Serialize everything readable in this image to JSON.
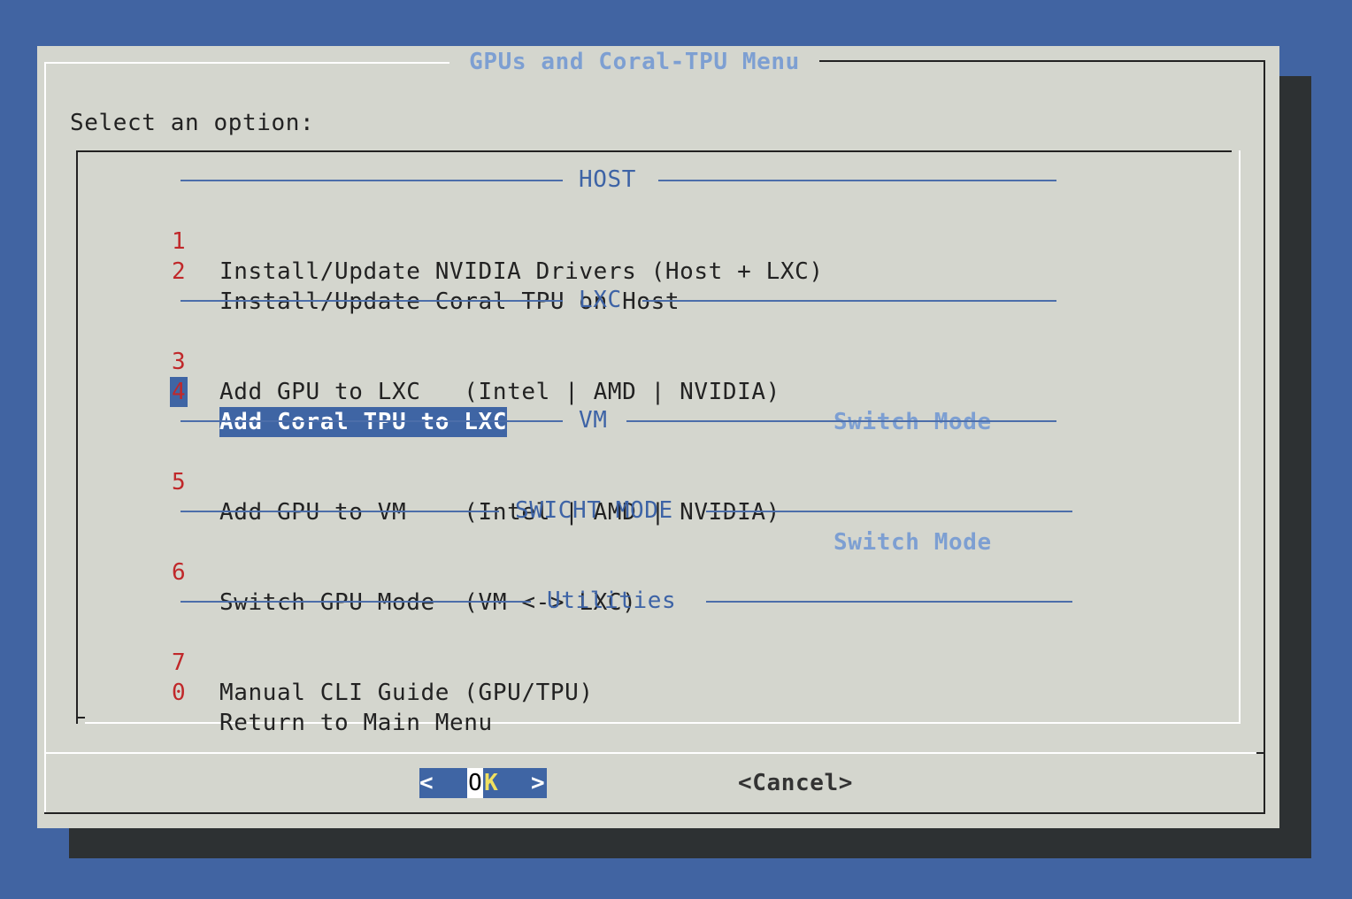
{
  "dialog": {
    "title": "GPUs and Coral-TPU Menu",
    "prompt": "Select an option:"
  },
  "sections": {
    "host": "HOST",
    "lxc": "LXC",
    "vm": "VM",
    "switch": "SWICHT MODE",
    "utilities": "Utilities"
  },
  "items": [
    {
      "num": "1",
      "text": "Install/Update NVIDIA Drivers (Host + LXC)"
    },
    {
      "num": "2",
      "text": "Install/Update Coral TPU on Host"
    },
    {
      "num": "3",
      "text": "Add GPU to LXC   (Intel | AMD | NVIDIA)",
      "mode": "Switch Mode"
    },
    {
      "num": "4",
      "text": "Add Coral TPU to LXC",
      "selected": true
    },
    {
      "num": "5",
      "text": "Add GPU to VM    (Intel | AMD | NVIDIA)",
      "mode": "Switch Mode"
    },
    {
      "num": "6",
      "text": "Switch GPU Mode  (VM <-> LXC)"
    },
    {
      "num": "7",
      "text": "Manual CLI Guide (GPU/TPU)"
    },
    {
      "num": "0",
      "text": "Return to Main Menu"
    }
  ],
  "buttons": {
    "ok_left": "<",
    "ok_o": "O",
    "ok_k": "K",
    "ok_right": ">",
    "cancel": "<Cancel>"
  },
  "colors": {
    "desktop": "#4164a2",
    "dialog": "#d4d6ce",
    "accent": "#3f65a4",
    "number": "#c0282a",
    "switch_mode": "#7d9fd2"
  }
}
